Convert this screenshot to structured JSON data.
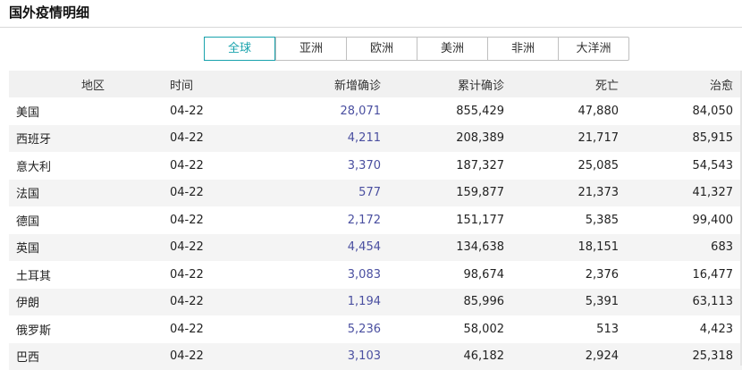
{
  "header": {
    "title": "国外疫情明细"
  },
  "tabs": [
    {
      "label": "全球",
      "active": true
    },
    {
      "label": "亚洲",
      "active": false
    },
    {
      "label": "欧洲",
      "active": false
    },
    {
      "label": "美洲",
      "active": false
    },
    {
      "label": "非洲",
      "active": false
    },
    {
      "label": "大洋洲",
      "active": false
    }
  ],
  "table": {
    "columns": [
      "地区",
      "时间",
      "新增确诊",
      "累计确诊",
      "死亡",
      "治愈"
    ],
    "rows": [
      [
        "美国",
        "04-22",
        "28,071",
        "855,429",
        "47,880",
        "84,050"
      ],
      [
        "西班牙",
        "04-22",
        "4,211",
        "208,389",
        "21,717",
        "85,915"
      ],
      [
        "意大利",
        "04-22",
        "3,370",
        "187,327",
        "25,085",
        "54,543"
      ],
      [
        "法国",
        "04-22",
        "577",
        "159,877",
        "21,373",
        "41,327"
      ],
      [
        "德国",
        "04-22",
        "2,172",
        "151,177",
        "5,385",
        "99,400"
      ],
      [
        "英国",
        "04-22",
        "4,454",
        "134,638",
        "18,151",
        "683"
      ],
      [
        "土耳其",
        "04-22",
        "3,083",
        "98,674",
        "2,376",
        "16,477"
      ],
      [
        "伊朗",
        "04-22",
        "1,194",
        "85,996",
        "5,391",
        "63,113"
      ],
      [
        "俄罗斯",
        "04-22",
        "5,236",
        "58,002",
        "513",
        "4,423"
      ],
      [
        "巴西",
        "04-22",
        "3,103",
        "46,182",
        "2,924",
        "25,318"
      ]
    ]
  },
  "colors": {
    "accent": "#19a3ad",
    "new_cases": "#4a4fa0",
    "header_bg": "#f1f1f1",
    "stripe": "#f4f4f4"
  }
}
